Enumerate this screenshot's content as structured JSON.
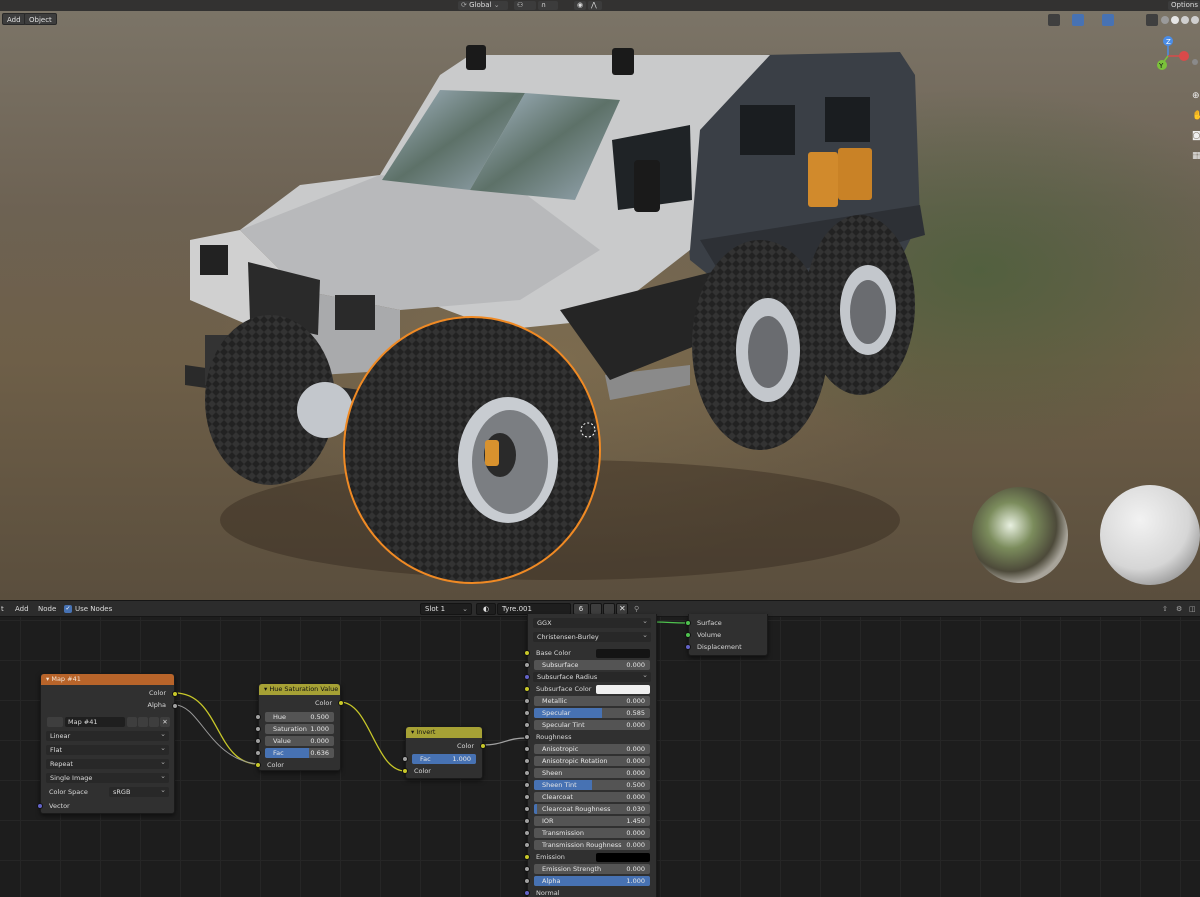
{
  "viewport": {
    "header": {
      "orientation": "Global",
      "options": "Options"
    },
    "buttons": {
      "add": "Add",
      "object": "Object"
    },
    "gizmo": {
      "z": "Z",
      "x": "X",
      "y": "Y"
    }
  },
  "node_editor": {
    "header": {
      "menu_view": "t",
      "menu_add": "Add",
      "menu_node": "Node",
      "use_nodes": "Use Nodes",
      "slot": "Slot 1",
      "material": "Tyre.001",
      "users": "6"
    },
    "image_node": {
      "title": "Map #41",
      "out_color": "Color",
      "out_alpha": "Alpha",
      "image_name": "Map #41",
      "interpolation": "Linear",
      "projection": "Flat",
      "extension": "Repeat",
      "source": "Single Image",
      "color_space_label": "Color Space",
      "color_space": "sRGB",
      "in_vector": "Vector"
    },
    "hsv_node": {
      "title": "Hue Saturation Value",
      "out_color": "Color",
      "hue_label": "Hue",
      "hue": "0.500",
      "sat_label": "Saturation",
      "sat": "1.000",
      "val_label": "Value",
      "val": "0.000",
      "fac_label": "Fac",
      "fac": "0.636",
      "fac_fraction": 0.636,
      "in_color": "Color"
    },
    "invert_node": {
      "title": "Invert",
      "out_color": "Color",
      "fac_label": "Fac",
      "fac": "1.000",
      "in_color": "Color"
    },
    "bsdf_node": {
      "distribution": "GGX",
      "subsurface_method": "Christensen-Burley",
      "rows": [
        {
          "label": "Base Color",
          "type": "color",
          "color": "#141414",
          "socket": "y"
        },
        {
          "label": "Subsurface",
          "value": "0.000",
          "fill": 0,
          "socket": "g"
        },
        {
          "label": "Subsurface Radius",
          "type": "dropdown",
          "socket": "p"
        },
        {
          "label": "Subsurface Color",
          "type": "color",
          "color": "#f0f0f0",
          "socket": "y"
        },
        {
          "label": "Metallic",
          "value": "0.000",
          "fill": 0,
          "socket": "g"
        },
        {
          "label": "Specular",
          "value": "0.585",
          "fill": 0.585,
          "socket": "g"
        },
        {
          "label": "Specular Tint",
          "value": "0.000",
          "fill": 0,
          "socket": "g"
        },
        {
          "label": "Roughness",
          "type": "linked",
          "socket": "g"
        },
        {
          "label": "Anisotropic",
          "value": "0.000",
          "fill": 0,
          "socket": "g"
        },
        {
          "label": "Anisotropic Rotation",
          "value": "0.000",
          "fill": 0,
          "socket": "g"
        },
        {
          "label": "Sheen",
          "value": "0.000",
          "fill": 0,
          "socket": "g"
        },
        {
          "label": "Sheen Tint",
          "value": "0.500",
          "fill": 0.5,
          "socket": "g"
        },
        {
          "label": "Clearcoat",
          "value": "0.000",
          "fill": 0,
          "socket": "g"
        },
        {
          "label": "Clearcoat Roughness",
          "value": "0.030",
          "fill": 0.03,
          "socket": "g"
        },
        {
          "label": "IOR",
          "value": "1.450",
          "fill": 0,
          "socket": "g"
        },
        {
          "label": "Transmission",
          "value": "0.000",
          "fill": 0,
          "socket": "g"
        },
        {
          "label": "Transmission Roughness",
          "value": "0.000",
          "fill": 0,
          "socket": "g"
        },
        {
          "label": "Emission",
          "type": "color",
          "color": "#000000",
          "socket": "y"
        },
        {
          "label": "Emission Strength",
          "value": "0.000",
          "fill": 0,
          "socket": "g"
        },
        {
          "label": "Alpha",
          "value": "1.000",
          "fill": 1,
          "socket": "g"
        },
        {
          "label": "Normal",
          "type": "linked",
          "socket": "p"
        }
      ]
    },
    "output_node": {
      "surface": "Surface",
      "volume": "Volume",
      "displacement": "Displacement"
    }
  }
}
